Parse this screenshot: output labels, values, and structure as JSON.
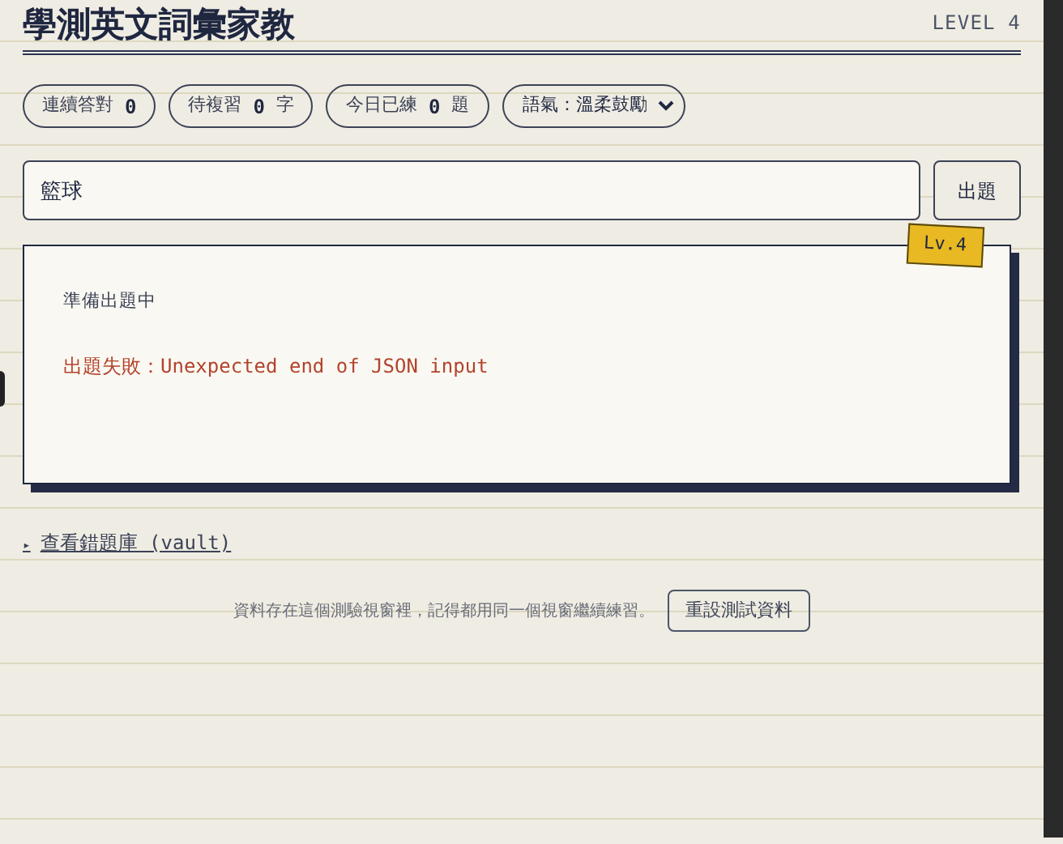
{
  "header": {
    "title": "學測英文詞彙家教",
    "level": "LEVEL 4"
  },
  "stats": [
    {
      "label": "連續答對",
      "value": "0"
    },
    {
      "label": "待複習",
      "value": "0",
      "unit": "字"
    },
    {
      "label": "今日已練",
      "value": "0",
      "unit": "題"
    }
  ],
  "tone_select": {
    "value": "語氣：溫柔鼓勵"
  },
  "topic_field": {
    "value": "籃球"
  },
  "generate_button": "出題",
  "card": {
    "badge": "Lv.4",
    "status": "準備出題中",
    "error": {
      "label": "出題失敗：",
      "message": "Unexpected end of JSON input"
    }
  },
  "vault_link": {
    "marker": "▸",
    "label": "查看錯題庫 (vault)"
  },
  "footer": {
    "note": "資料存在這個測驗視窗裡，記得都用同一個視窗繼續練習。",
    "reset_button": "重設測試資料"
  }
}
